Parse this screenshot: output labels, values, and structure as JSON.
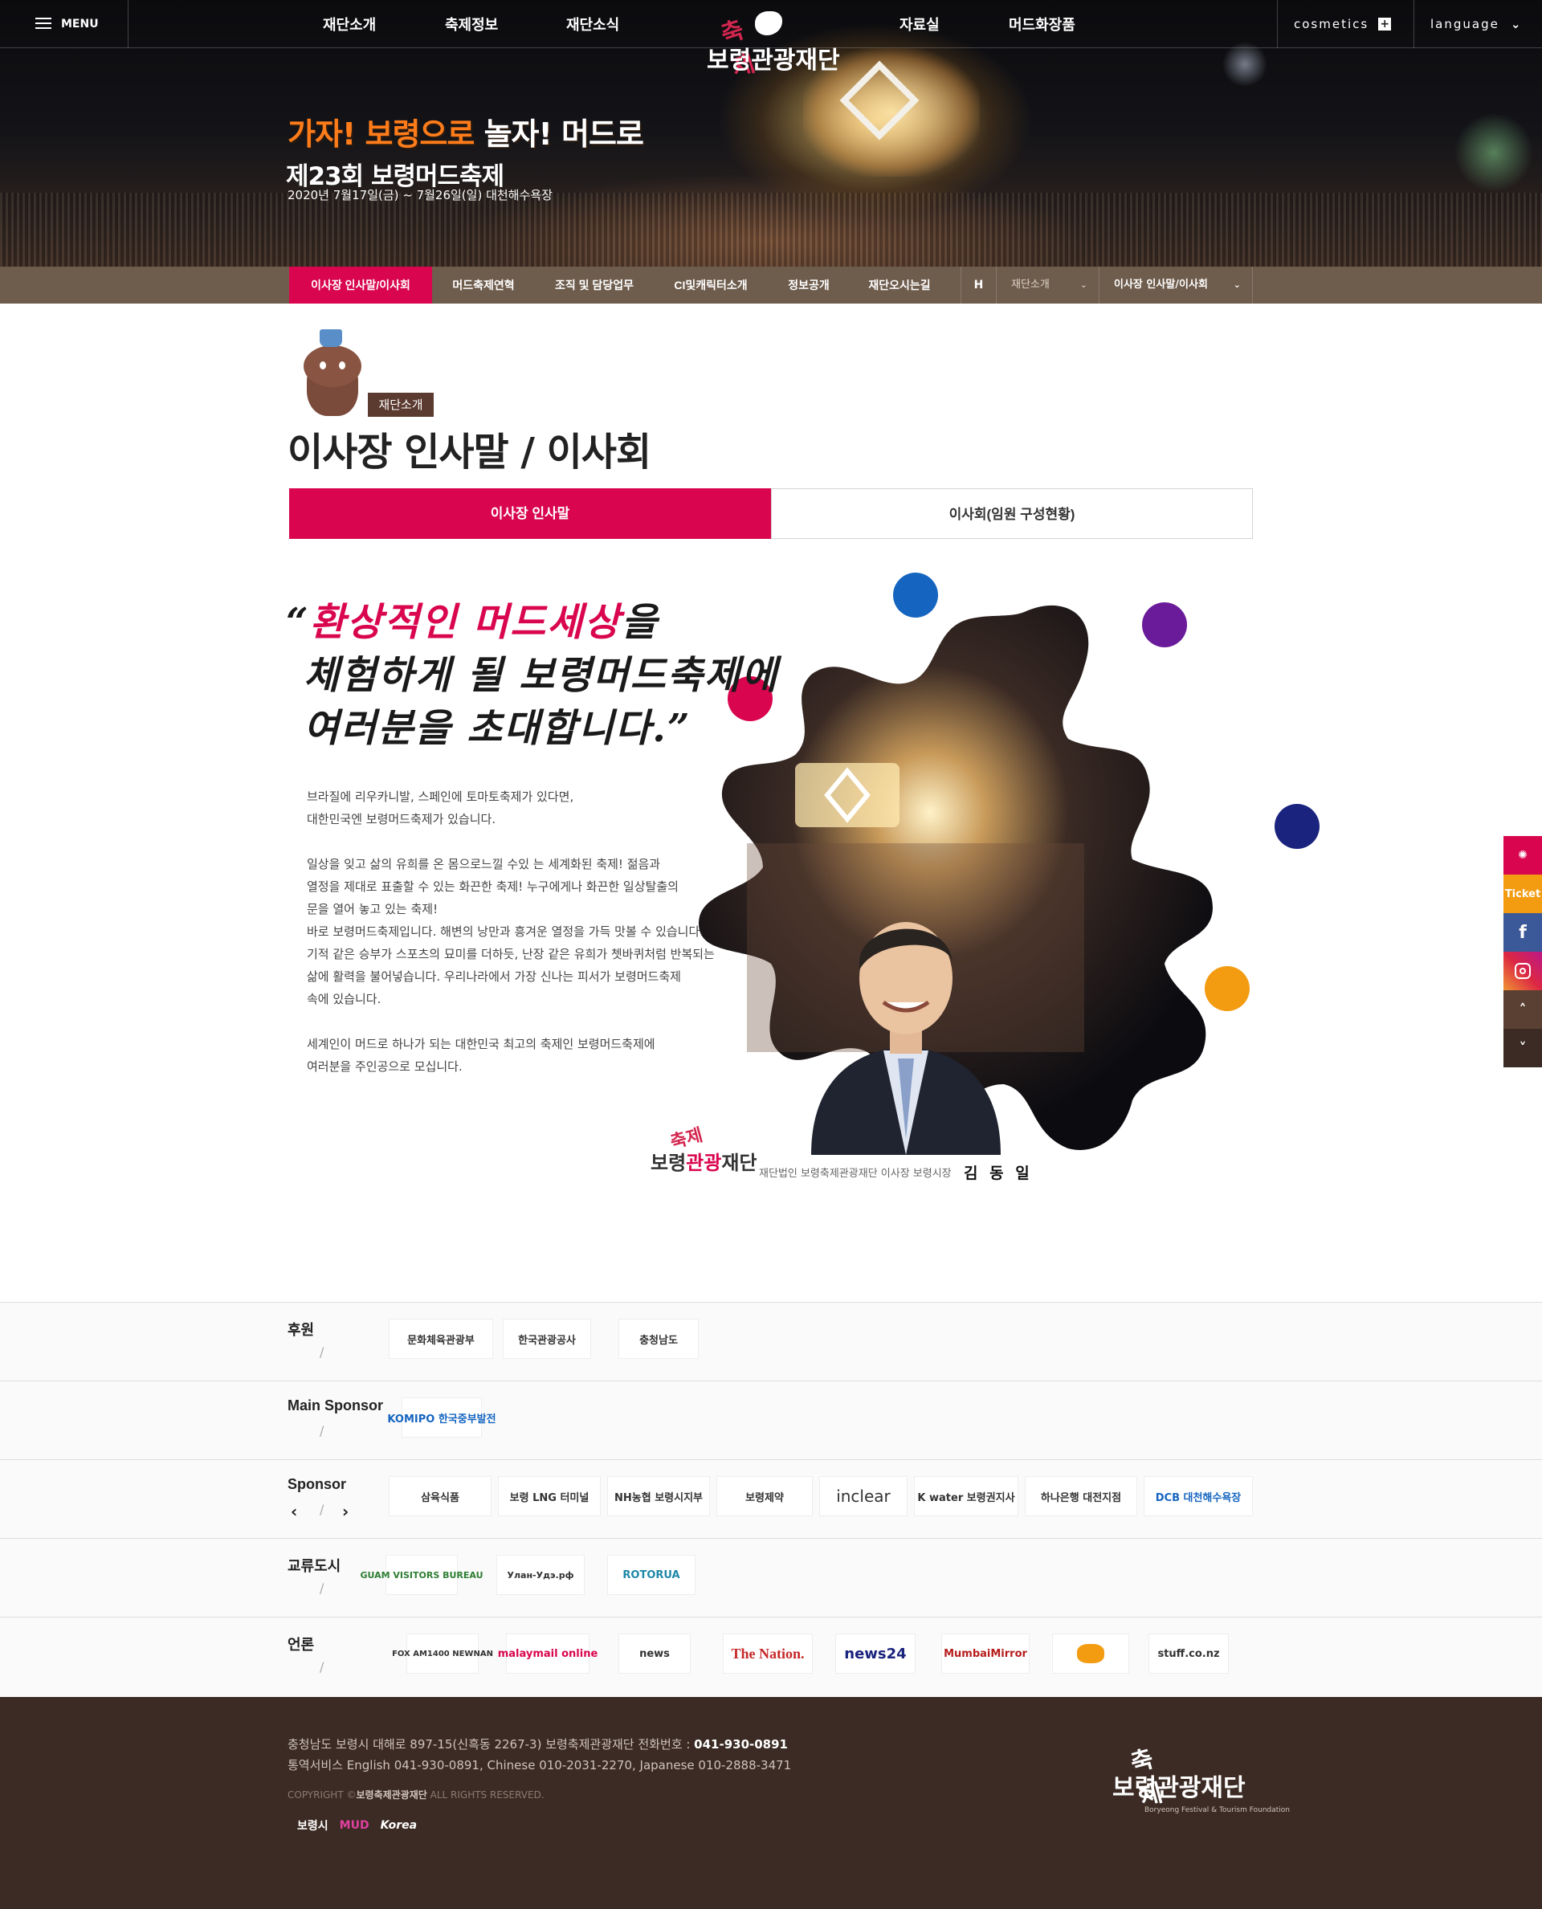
{
  "header": {
    "menu_label": "MENU",
    "nav": [
      "재단소개",
      "축제정보",
      "재단소식",
      "자료실",
      "머드화장품"
    ],
    "cosmetics_label": "cosmetics",
    "language_label": "language",
    "logo_top": "축제",
    "logo_bottom": "보령관광재단"
  },
  "hero": {
    "slogan_a": "가자! 보령으로 ",
    "slogan_b": "놀자! 머드로",
    "title": "제23회 보령머드축제",
    "date": "2020년 7월17일(금) ~ 7월26일(일) 대천해수욕장"
  },
  "subnav": {
    "items": [
      "이사장 인사말/이사회",
      "머드축제연혁",
      "조직 및 담당업무",
      "CI및캐릭터소개",
      "정보공개",
      "재단오시는길"
    ],
    "home_label": "H",
    "crumb1": "재단소개",
    "crumb2": "이사장 인사말/이사회",
    "chevron": "⌄"
  },
  "page": {
    "category_badge": "재단소개",
    "title": "이사장 인사말 / 이사회",
    "tabs": [
      "이사장 인사말",
      "이사회(임원 구성현황)"
    ]
  },
  "greeting": {
    "quote_open": "“",
    "quote_em": "환상적인 머드세상",
    "quote_line1_rest": "을",
    "quote_line2": "체험하게 될 보령머드축제에",
    "quote_line3": "여러분을 초대합니다.",
    "quote_close": "”",
    "paragraphs": [
      "브라질에 리우카니발, 스페인에 토마토축제가 있다면,\n대한민국엔 보령머드축제가 있습니다.",
      "일상을 잊고 삶의 유희를 온 몸으로느낄 수있 는 세계화된 축제! 젊음과\n열정을 제대로 표출할 수 있는 화끈한 축제! 누구에게나 화끈한 일상탈출의\n문을 열어 놓고 있는 축제!\n바로 보령머드축제입니다. 해변의 낭만과 흥겨운 열정을 가득 맛볼 수 있습니다.\n기적 같은 승부가 스포츠의 묘미를 더하듯, 난장 같은 유희가 쳇바퀴처럼 반복되는\n삶에 활력을 불어넣습니다. 우리나라에서 가장 신나는 피서가 보령머드축제\n속에 있습니다.",
      "세계인이 머드로 하나가 되는 대한민국 최고의 축제인 보령머드축제에\n여러분을 주인공으로 모십니다."
    ],
    "sign_logo_top": "축제",
    "sign_logo_a": "보령",
    "sign_logo_b": "관광",
    "sign_logo_c": "재단",
    "sign_text": "재단법인 보령축제관광재단 이사장 보령시장",
    "sign_name": "김 동 일"
  },
  "sponsors": {
    "rows": [
      {
        "label": "후원",
        "logos": [
          "문화체육관광부",
          "한국관광공사",
          "충청남도"
        ]
      },
      {
        "label": "Main Sponsor",
        "logos": [
          "KOMIPO 한국중부발전"
        ]
      },
      {
        "label": "Sponsor",
        "logos": [
          "삼육식품",
          "보령 LNG 터미널",
          "NH농협 보령시지부",
          "보령제약",
          "inclear",
          "K water 보령권지사",
          "하나은행 대전지점",
          "DCB 대천해수욕장"
        ]
      },
      {
        "label": "교류도시",
        "logos": [
          "GUAM VISITORS BUREAU",
          "Улан-Удэ.рф",
          "ROTORUA"
        ]
      },
      {
        "label": "언론",
        "logos": [
          "FOX AM1400 NEWNAN",
          "malaymail online",
          "news",
          "The Nation.",
          "news24",
          "MumbaiMirror",
          "",
          "stuff.co.nz"
        ]
      }
    ],
    "slash": "/",
    "prev": "‹",
    "next": "›"
  },
  "footer": {
    "address": "충청남도 보령시 대해로 897-15(신흑동 2267-3) 보령축제관광재단 전화번호 : ",
    "phone": "041-930-0891",
    "interpret": "통역서비스 English 041-930-0891, Chinese 010-2031-2270, Japanese 010-2888-3471",
    "copy_a": "COPYRIGHT ©",
    "copy_b": "보령축제관광재단",
    "copy_c": " ALL RIGHTS RESERVED.",
    "small_logos": [
      "보령시",
      "MUD",
      "Korea"
    ],
    "logo_top": "축제",
    "logo_bottom": "보령관광재단",
    "logo_en": "Boryeong Festival & Tourism Foundation"
  },
  "quickmenu": {
    "ticket": "Ticket",
    "facebook": "f",
    "up": "˄",
    "down": "˅"
  },
  "colors": {
    "accent": "#d9054e",
    "subnav_bg": "#6e5c4c",
    "footer_bg": "#3b2b24",
    "dot_blue": "#1565c0",
    "dot_purple": "#6a1b9a",
    "dot_pink": "#d9054e",
    "dot_navy": "#1a237e",
    "dot_orange": "#f39c12",
    "ticket_bg": "#f39c12"
  }
}
